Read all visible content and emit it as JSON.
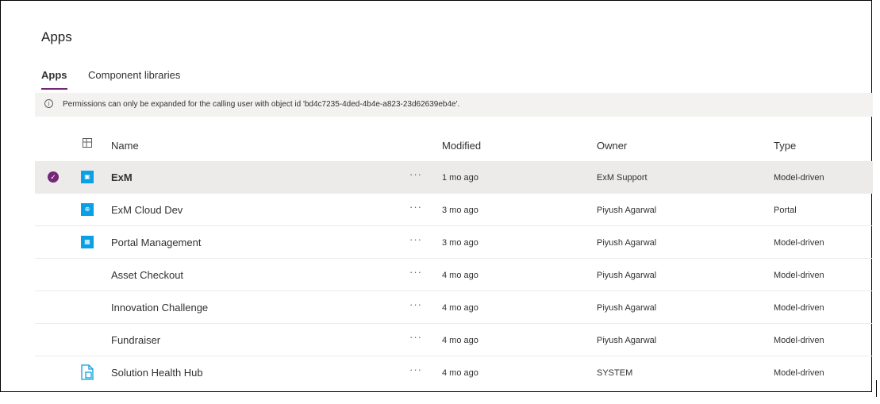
{
  "page": {
    "title": "Apps"
  },
  "tabs": [
    {
      "label": "Apps",
      "active": true
    },
    {
      "label": "Component libraries",
      "active": false
    }
  ],
  "banner": {
    "icon": "info-icon",
    "message": "Permissions can only be expanded for the calling user with object id 'bd4c7235-4ded-4b4e-a823-23d62639eb4e'."
  },
  "columns": {
    "name": "Name",
    "modified": "Modified",
    "owner": "Owner",
    "type": "Type"
  },
  "rows": [
    {
      "name": "ExM",
      "more": "···",
      "modified": "1 mo ago",
      "owner": "ExM Support",
      "type": "Model-driven",
      "selected": true,
      "icon": "model-app-icon"
    },
    {
      "name": "ExM Cloud Dev",
      "more": "···",
      "modified": "3 mo ago",
      "owner": "Piyush Agarwal",
      "type": "Portal",
      "selected": false,
      "icon": "portal-globe-icon"
    },
    {
      "name": "Portal Management",
      "more": "···",
      "modified": "3 mo ago",
      "owner": "Piyush Agarwal",
      "type": "Model-driven",
      "selected": false,
      "icon": "model-app-icon"
    },
    {
      "name": "Asset Checkout",
      "more": "···",
      "modified": "4 mo ago",
      "owner": "Piyush Agarwal",
      "type": "Model-driven",
      "selected": false,
      "icon": ""
    },
    {
      "name": "Innovation Challenge",
      "more": "···",
      "modified": "4 mo ago",
      "owner": "Piyush Agarwal",
      "type": "Model-driven",
      "selected": false,
      "icon": ""
    },
    {
      "name": "Fundraiser",
      "more": "···",
      "modified": "4 mo ago",
      "owner": "Piyush Agarwal",
      "type": "Model-driven",
      "selected": false,
      "icon": ""
    },
    {
      "name": "Solution Health Hub",
      "more": "···",
      "modified": "4 mo ago",
      "owner": "SYSTEM",
      "type": "Model-driven",
      "selected": false,
      "icon": "document-app-icon"
    }
  ],
  "colors": {
    "accent": "#742774",
    "app_icon": "#0aa0e6",
    "banner_bg": "#f3f2f1",
    "selected_row": "#edebe9"
  }
}
